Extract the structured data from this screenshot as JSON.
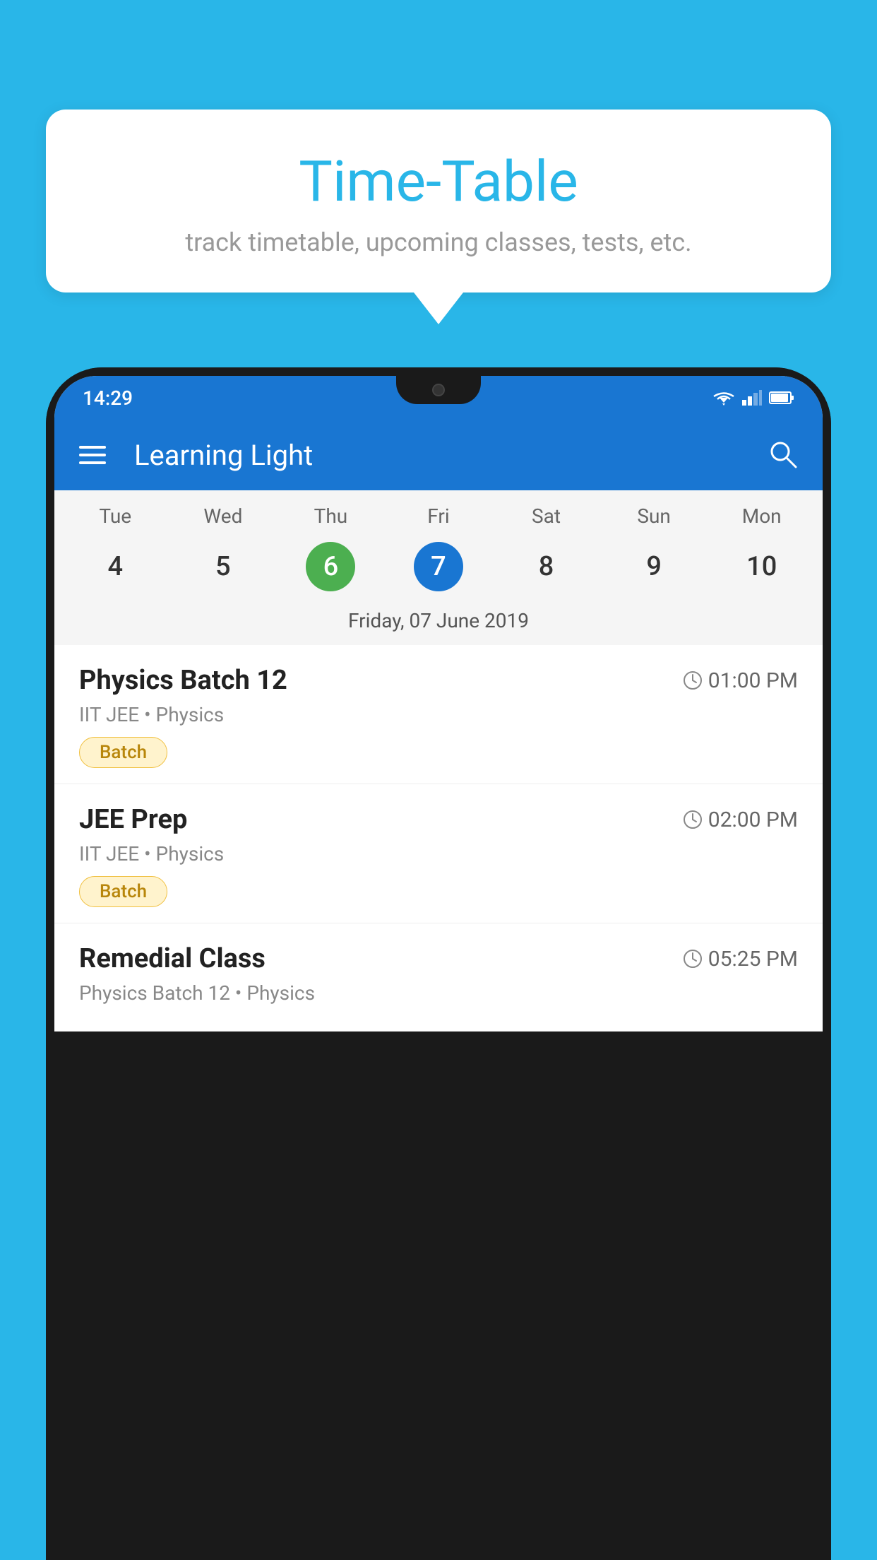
{
  "background_color": "#29b6e8",
  "speech_bubble": {
    "title": "Time-Table",
    "subtitle": "track timetable, upcoming classes, tests, etc."
  },
  "app": {
    "app_bar_title": "Learning Light",
    "status_time": "14:29"
  },
  "calendar": {
    "day_labels": [
      "Tue",
      "Wed",
      "Thu",
      "Fri",
      "Sat",
      "Sun",
      "Mon"
    ],
    "dates": [
      "4",
      "5",
      "6",
      "7",
      "8",
      "9",
      "10"
    ],
    "today_index": 2,
    "selected_index": 3,
    "selected_date_label": "Friday, 07 June 2019"
  },
  "schedule_items": [
    {
      "title": "Physics Batch 12",
      "time": "01:00 PM",
      "subtitle": "IIT JEE • Physics",
      "tag": "Batch"
    },
    {
      "title": "JEE Prep",
      "time": "02:00 PM",
      "subtitle": "IIT JEE • Physics",
      "tag": "Batch"
    },
    {
      "title": "Remedial Class",
      "time": "05:25 PM",
      "subtitle": "Physics Batch 12 • Physics",
      "tag": null
    }
  ],
  "icons": {
    "hamburger": "menu-icon",
    "search": "search-icon",
    "clock": "clock-icon"
  }
}
